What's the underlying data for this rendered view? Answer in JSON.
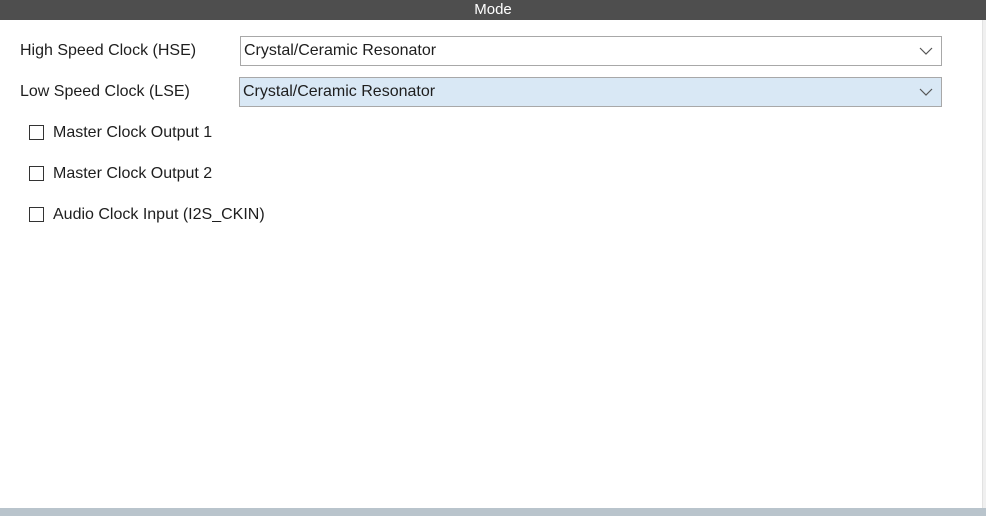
{
  "header": {
    "title": "Mode"
  },
  "clock_settings": [
    {
      "label": "High Speed Clock (HSE)",
      "value": "Crystal/Ceramic Resonator",
      "highlighted": false
    },
    {
      "label": "Low Speed Clock (LSE)",
      "value": "Crystal/Ceramic Resonator",
      "highlighted": true
    }
  ],
  "checkboxes": [
    {
      "label": "Master Clock Output 1",
      "checked": false
    },
    {
      "label": "Master Clock Output 2",
      "checked": false
    },
    {
      "label": "Audio Clock Input (I2S_CKIN)",
      "checked": false
    }
  ],
  "colors": {
    "header_bg": "#4e4e4e",
    "highlight_bg": "#d9e8f5",
    "bottom_bar": "#b9c4cc"
  }
}
